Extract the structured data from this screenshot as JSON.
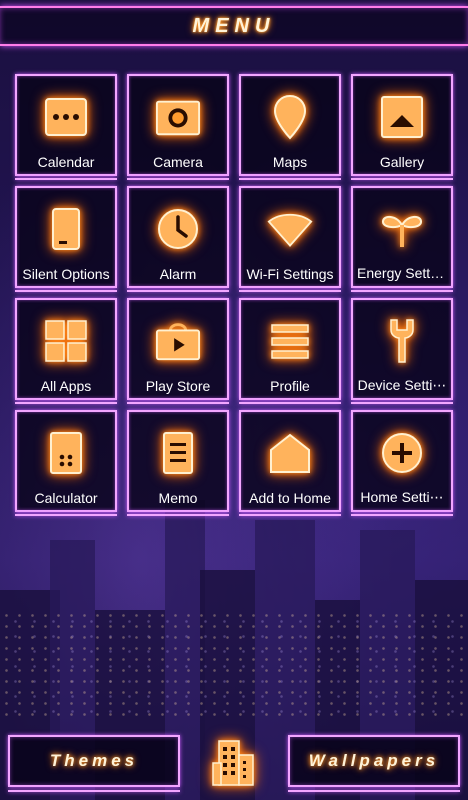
{
  "header": {
    "title": "MENU"
  },
  "tiles": [
    {
      "label": "Calendar",
      "icon": "calendar-icon"
    },
    {
      "label": "Camera",
      "icon": "camera-icon"
    },
    {
      "label": "Maps",
      "icon": "map-pin-icon"
    },
    {
      "label": "Gallery",
      "icon": "gallery-icon"
    },
    {
      "label": "Silent Options",
      "icon": "phone-icon"
    },
    {
      "label": "Alarm",
      "icon": "clock-icon"
    },
    {
      "label": "Wi-Fi Settings",
      "icon": "wifi-icon"
    },
    {
      "label": "Energy Setti⋯",
      "icon": "sprout-icon"
    },
    {
      "label": "All Apps",
      "icon": "grid-icon"
    },
    {
      "label": "Play Store",
      "icon": "store-bag-icon"
    },
    {
      "label": "Profile",
      "icon": "list-lines-icon"
    },
    {
      "label": "Device Setti⋯",
      "icon": "wrench-icon"
    },
    {
      "label": "Calculator",
      "icon": "calculator-icon"
    },
    {
      "label": "Memo",
      "icon": "memo-icon"
    },
    {
      "label": "Add to Home",
      "icon": "house-icon"
    },
    {
      "label": "Home Setti⋯",
      "icon": "plus-circle-icon"
    }
  ],
  "bottom": {
    "themes_label": "Themes",
    "wallpapers_label": "Wallpapers",
    "center_icon": "buildings-icon"
  },
  "colors": {
    "glow_orange": "#ff7a00",
    "frame_pink": "#f2a6ff",
    "background": "#1a0f3d"
  }
}
